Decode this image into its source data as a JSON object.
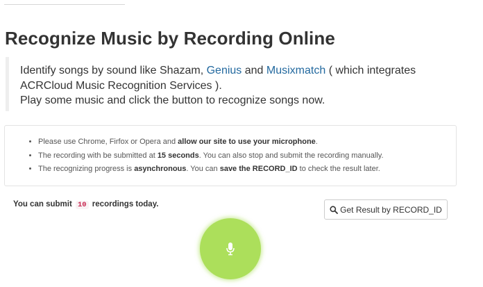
{
  "page": {
    "title": "Recognize Music by Recording Online"
  },
  "intro": {
    "line1_before": "Identify songs by sound like Shazam, ",
    "link_genius": "Genius",
    "line1_and": " and ",
    "link_musixmatch": "Musixmatch",
    "line1_after": " ( which integrates ACRCloud Music Recognition Services ).",
    "line2": "Play some music and click the button to recognize songs now."
  },
  "notice": {
    "item1": {
      "text": "Please use Chrome, Firfox or Opera and ",
      "bold": "allow our site to use your microphone",
      "end": "."
    },
    "item2": {
      "text": "The recording with be submitted at ",
      "bold": "15 seconds",
      "end": ". You can also stop and submit the recording manually."
    },
    "item3": {
      "text": "The recognizing progress is ",
      "bold1": "asynchronous",
      "middle": ". You can ",
      "bold2": "save the RECORD_ID",
      "end": " to check the result later."
    }
  },
  "submit": {
    "prefix": "You can submit",
    "count": "10",
    "suffix": "recordings today."
  },
  "result_button": {
    "label": "Get Result by RECORD_ID",
    "icon": "search-icon"
  },
  "record_button": {
    "icon": "microphone-icon",
    "color": "#acdf5b"
  },
  "colors": {
    "link": "#23699f",
    "badge_text": "#c7254e",
    "badge_bg": "#f9f2f4"
  }
}
